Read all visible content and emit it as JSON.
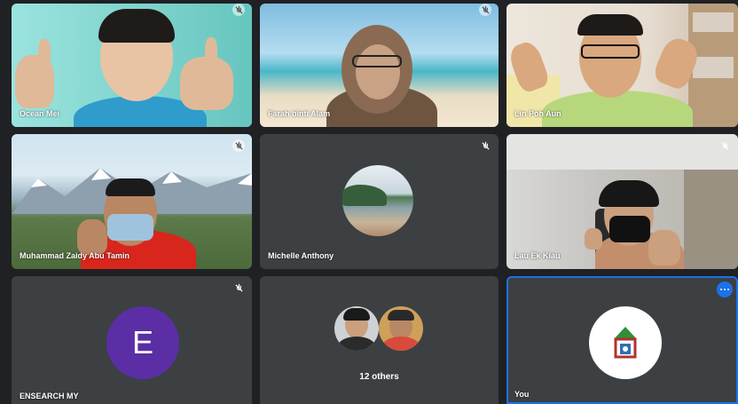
{
  "participants": [
    {
      "name": "Ocean Mei",
      "muted": true
    },
    {
      "name": "Farah binti Alam",
      "muted": true
    },
    {
      "name": "Lin Poh Aun",
      "muted": false
    },
    {
      "name": "Muhammad Zaidy Abu Tamin",
      "muted": true
    },
    {
      "name": "Michelle Anthony",
      "muted": true
    },
    {
      "name": "Lau Ek Kiau",
      "muted": true
    },
    {
      "name": "ENSEARCH MY",
      "muted": true,
      "avatar_letter": "E",
      "avatar_color": "#5b2ea6"
    },
    {
      "name": "12 others"
    },
    {
      "name": "You",
      "highlighted": true
    }
  ],
  "colors": {
    "background": "#202124",
    "tile": "#3c4043",
    "active_border": "#1a73e8"
  },
  "icons": {
    "mute": "mic-off-icon",
    "more": "more-options-icon"
  }
}
